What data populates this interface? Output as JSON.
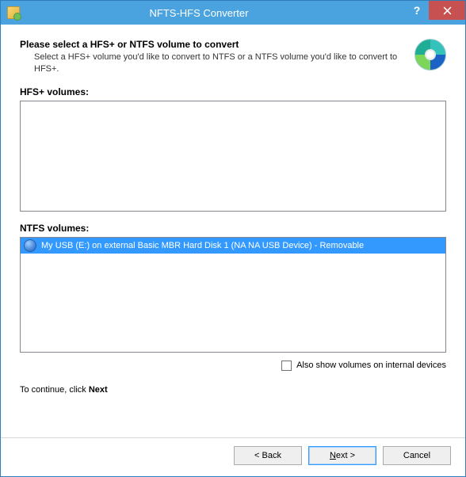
{
  "window": {
    "title": "NFTS-HFS Converter"
  },
  "header": {
    "headline": "Please select a HFS+ or NTFS volume to convert",
    "subhead": "Select a HFS+ volume you'd like to convert to NTFS or a NTFS volume you'd like to convert to HFS+."
  },
  "sections": {
    "hfs_label": "HFS+ volumes:",
    "ntfs_label": "NTFS volumes:"
  },
  "ntfs_volumes": [
    {
      "label": "My USB (E:) on external Basic MBR Hard Disk 1 (NA NA USB Device) - Removable",
      "selected": true
    }
  ],
  "options": {
    "show_internal_label": "Also show volumes on internal devices",
    "show_internal_checked": false
  },
  "continue_hint": {
    "prefix": "To continue, click ",
    "bold": "Next"
  },
  "buttons": {
    "back": "< Back",
    "next_prefix": "N",
    "next_rest": "ext >",
    "cancel": "Cancel"
  }
}
